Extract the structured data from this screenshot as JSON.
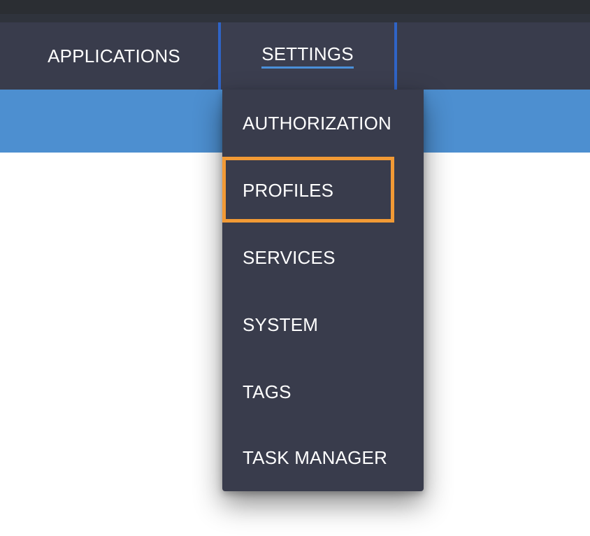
{
  "nav": {
    "items": [
      {
        "label": "APPLICATIONS"
      },
      {
        "label": "SETTINGS"
      }
    ],
    "active_accent": "#2f64c6",
    "underline_color": "#4a90d9"
  },
  "dropdown": {
    "items": [
      {
        "label": "AUTHORIZATION"
      },
      {
        "label": "PROFILES"
      },
      {
        "label": "SERVICES"
      },
      {
        "label": "SYSTEM"
      },
      {
        "label": "TAGS"
      },
      {
        "label": "TASK MANAGER"
      }
    ],
    "highlight_color": "#f29a35"
  },
  "colors": {
    "navbar": "#393c4c",
    "banner": "#4d8fd0",
    "dropdown": "#393c4c"
  }
}
